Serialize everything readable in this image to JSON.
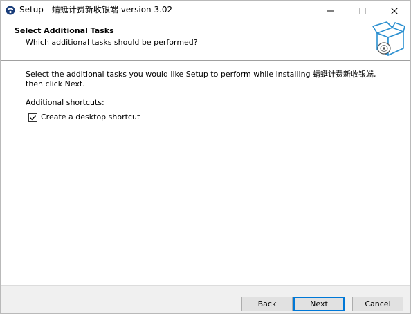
{
  "window": {
    "title": "Setup - 蜻蜓计费新收银端 version 3.02"
  },
  "header": {
    "title": "Select Additional Tasks",
    "subtitle": "Which additional tasks should be performed?"
  },
  "main": {
    "instruction": "Select the additional tasks you would like Setup to perform while installing 蜻蜓计费新收银端, then click Next.",
    "group_label": "Additional shortcuts:",
    "tasks": [
      {
        "label": "Create a desktop shortcut",
        "checked": true
      }
    ]
  },
  "buttons": {
    "back": "Back",
    "next": "Next",
    "cancel": "Cancel"
  }
}
